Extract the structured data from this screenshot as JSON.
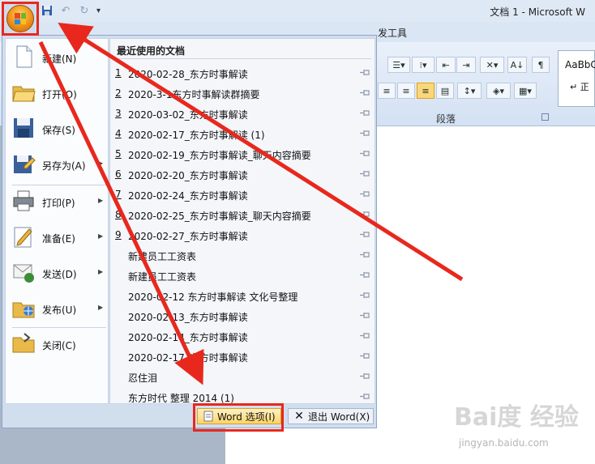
{
  "window": {
    "title": "文档 1 - Microsoft W",
    "tab_dev_partial": "发工具",
    "group_label": "段落",
    "styles_sample": "AaBbC",
    "styles_name": "↵ 正"
  },
  "quick_access": {
    "save_icon": "save-icon",
    "undo_icon": "undo-icon",
    "redo_icon": "redo-icon",
    "customize_glyph": "▾"
  },
  "office_menu": {
    "commands": [
      {
        "label": "新建(N)",
        "icon": "new-document-icon",
        "has_submenu": false
      },
      {
        "label": "打开(O)",
        "icon": "open-folder-icon",
        "has_submenu": false
      },
      {
        "label": "保存(S)",
        "icon": "save-icon",
        "has_submenu": false
      },
      {
        "label": "另存为(A)",
        "icon": "save-as-icon",
        "has_submenu": true
      },
      {
        "label": "打印(P)",
        "icon": "print-icon",
        "has_submenu": true
      },
      {
        "label": "准备(E)",
        "icon": "prepare-icon",
        "has_submenu": true
      },
      {
        "label": "发送(D)",
        "icon": "send-icon",
        "has_submenu": true
      },
      {
        "label": "发布(U)",
        "icon": "publish-icon",
        "has_submenu": true
      },
      {
        "label": "关闭(C)",
        "icon": "close-folder-icon",
        "has_submenu": false
      }
    ],
    "submenu_arrow": "▶",
    "recent_title": "最近使用的文档",
    "recent_docs": [
      {
        "num": "1",
        "name": "2020-02-28_东方时事解读"
      },
      {
        "num": "2",
        "name": "2020-3-1东方时事解读群摘要"
      },
      {
        "num": "3",
        "name": "2020-03-02_东方时事解读"
      },
      {
        "num": "4",
        "name": "2020-02-17_东方时事解读 (1)"
      },
      {
        "num": "5",
        "name": "2020-02-19_东方时事解读_聊天内容摘要"
      },
      {
        "num": "6",
        "name": "2020-02-20_东方时事解读"
      },
      {
        "num": "7",
        "name": "2020-02-24_东方时事解读"
      },
      {
        "num": "8",
        "name": "2020-02-25_东方时事解读_聊天内容摘要"
      },
      {
        "num": "9",
        "name": "2020-02-27_东方时事解读"
      },
      {
        "num": "",
        "name": "新建员工工资表"
      },
      {
        "num": "",
        "name": "新建员工工资表"
      },
      {
        "num": "",
        "name": "2020-02-12  东方时事解读 文化号整理"
      },
      {
        "num": "",
        "name": "2020-02-13_东方时事解读"
      },
      {
        "num": "",
        "name": "2020-02-14_东方时事解读"
      },
      {
        "num": "",
        "name": "2020-02-17_东方时事解读"
      },
      {
        "num": "",
        "name": "忍住泪"
      },
      {
        "num": "",
        "name": "东方时代 整理  2014  (1)"
      }
    ],
    "word_options_label": "Word 选项(I)",
    "exit_word_label": "退出 Word(X)"
  },
  "watermark": {
    "main": "Bai度 经验",
    "sub": "jingyan.baidu.com"
  },
  "colors": {
    "annotation_red": "#e8281d",
    "menu_bg": "#d1deee",
    "highlight_yellow": "#fdd46b"
  }
}
